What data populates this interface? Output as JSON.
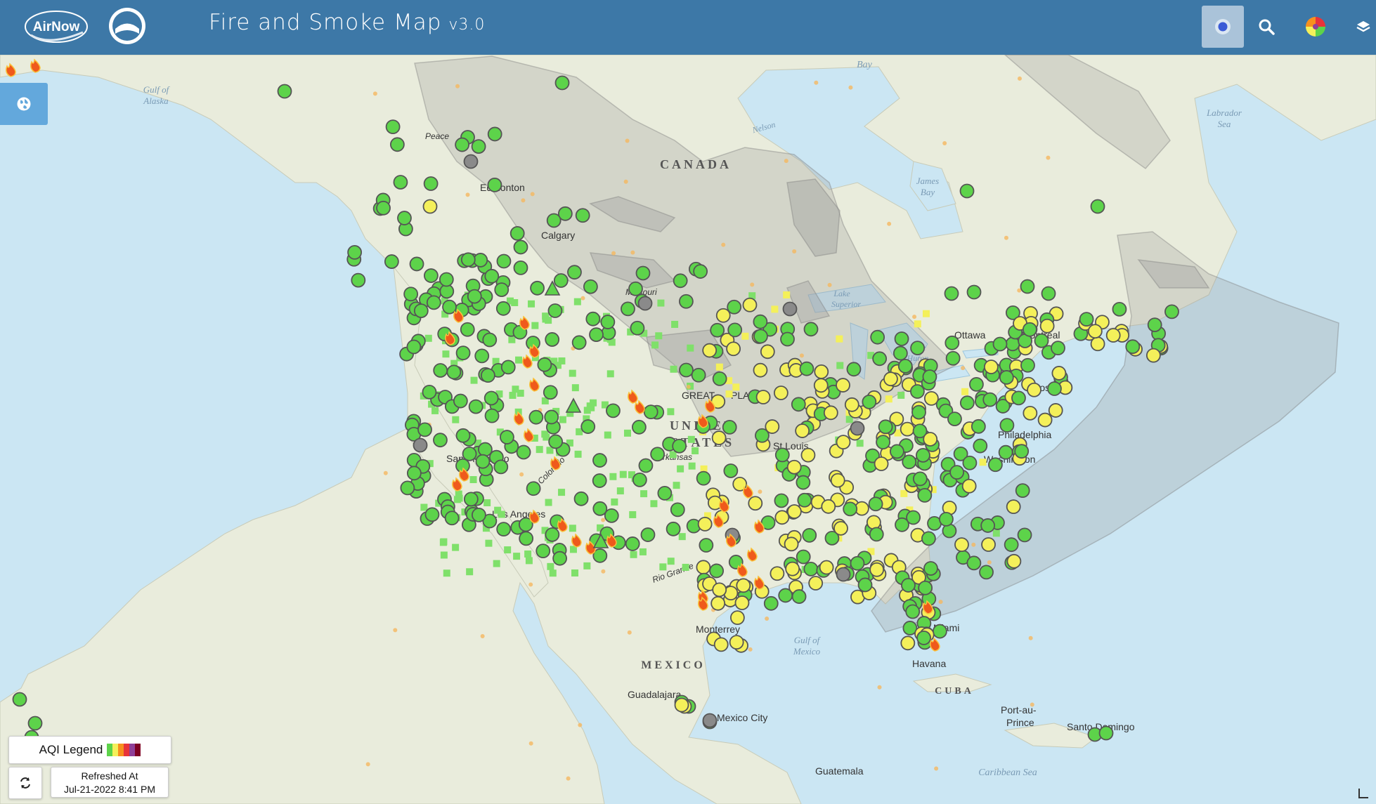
{
  "header": {
    "logo_text": "AirNow",
    "title": "Fire and Smoke Map",
    "version": "v3.0"
  },
  "colors": {
    "header_bg": "#3d78a7",
    "aqi_good": "#5dd34a",
    "aqi_moderate": "#f4f05a",
    "smoke_light": "#b8b8b8",
    "fire": "#ef5a1c"
  },
  "icons": {
    "location": "location-dot-icon",
    "search": "search-icon",
    "palette": "color-wheel-icon",
    "layers": "layers-icon",
    "globe": "globe-icon",
    "refresh": "refresh-icon"
  },
  "legend": {
    "label": "AQI Legend",
    "swatch_colors": [
      "#5dd34a",
      "#f4f05a",
      "#f7901e",
      "#e8333a",
      "#8f3f97",
      "#7e0023"
    ]
  },
  "refresh": {
    "label": "Refreshed At",
    "timestamp": "Jul-21-2022 8:41 PM"
  },
  "map_labels": {
    "countries": [
      "CANADA",
      "UNITED",
      "STATES",
      "MEXICO",
      "CUBA"
    ],
    "water": [
      "Gulf of",
      "Alaska",
      "Bay",
      "Labrador",
      "Sea",
      "James",
      "Bay",
      "Gulf of",
      "Mexico",
      "Caribbean Sea",
      "Nelson",
      "Lake",
      "Superior",
      "Lake",
      "Huron"
    ],
    "places": [
      "Edmonton",
      "Calgary",
      "Ottawa",
      "Montreal",
      "Boston",
      "Philadelphia",
      "Washington",
      "San Francisco",
      "Los Angeles",
      "St Louis",
      "Miami",
      "Havana",
      "Monterrey",
      "Guadalajara",
      "Mexico City",
      "Port-au-",
      "Prince",
      "Santo Domingo",
      "Guatemala",
      "GREAT",
      "PLAINS",
      "Missouri",
      "Arkansas",
      "Colorado",
      "Rio Grande",
      "Peace"
    ]
  }
}
